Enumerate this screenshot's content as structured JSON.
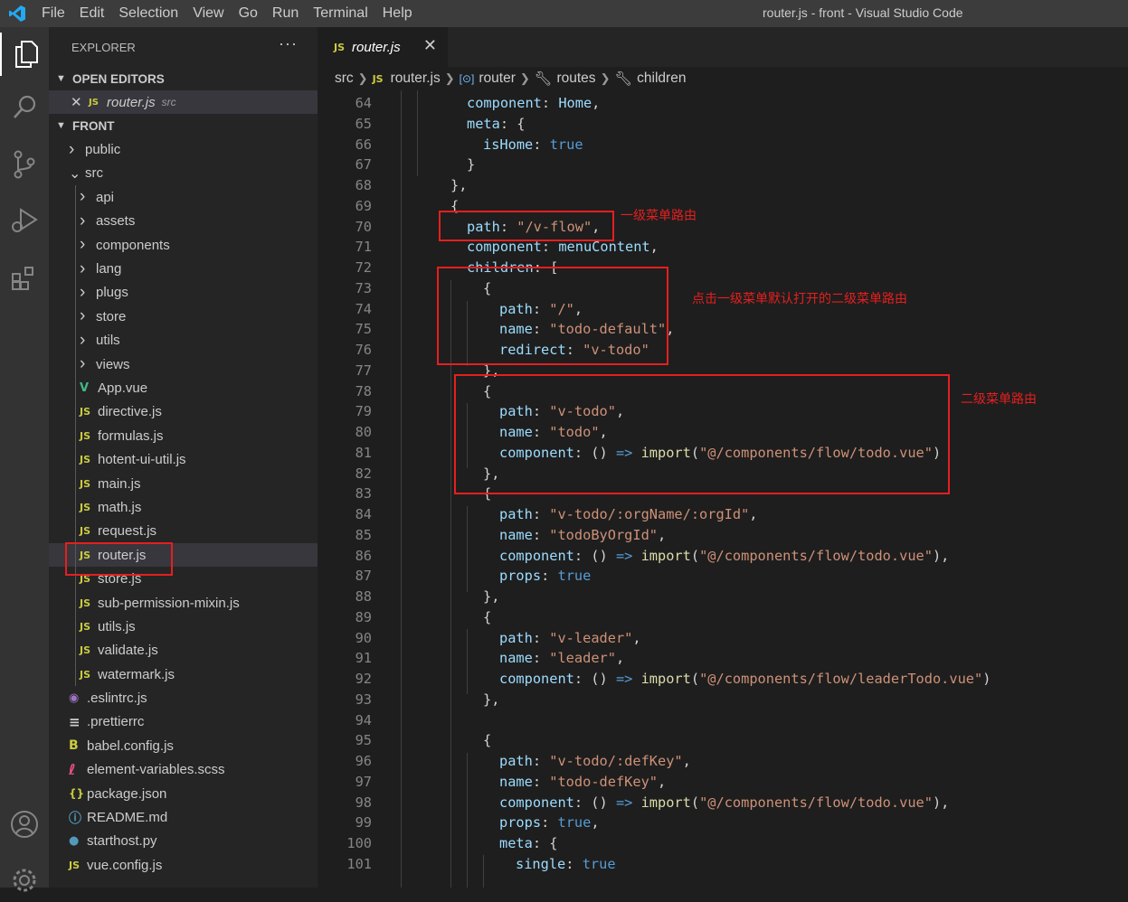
{
  "window": {
    "title": "router.js - front - Visual Studio Code"
  },
  "menu": [
    "File",
    "Edit",
    "Selection",
    "View",
    "Go",
    "Run",
    "Terminal",
    "Help"
  ],
  "activity_icons": [
    "files-icon",
    "search-icon",
    "source-control-icon",
    "run-debug-icon",
    "extensions-icon",
    "account-icon",
    "settings-gear-icon"
  ],
  "explorer": {
    "title": "EXPLORER",
    "more": "···",
    "open_editors_label": "OPEN EDITORS",
    "open_editor": {
      "name": "router.js",
      "dir": "src"
    },
    "project_label": "FRONT",
    "tree": [
      {
        "name": "public",
        "type": "folder",
        "level": 1
      },
      {
        "name": "src",
        "type": "folder-open",
        "level": 1
      },
      {
        "name": "api",
        "type": "folder",
        "level": 2
      },
      {
        "name": "assets",
        "type": "folder",
        "level": 2
      },
      {
        "name": "components",
        "type": "folder",
        "level": 2
      },
      {
        "name": "lang",
        "type": "folder",
        "level": 2
      },
      {
        "name": "plugs",
        "type": "folder",
        "level": 2
      },
      {
        "name": "store",
        "type": "folder",
        "level": 2
      },
      {
        "name": "utils",
        "type": "folder",
        "level": 2
      },
      {
        "name": "views",
        "type": "folder",
        "level": 2
      },
      {
        "name": "App.vue",
        "type": "vue",
        "level": 2
      },
      {
        "name": "directive.js",
        "type": "js",
        "level": 2
      },
      {
        "name": "formulas.js",
        "type": "js",
        "level": 2
      },
      {
        "name": "hotent-ui-util.js",
        "type": "js",
        "level": 2
      },
      {
        "name": "main.js",
        "type": "js",
        "level": 2
      },
      {
        "name": "math.js",
        "type": "js",
        "level": 2
      },
      {
        "name": "request.js",
        "type": "js",
        "level": 2
      },
      {
        "name": "router.js",
        "type": "js",
        "level": 2,
        "selected": true
      },
      {
        "name": "store.js",
        "type": "js",
        "level": 2
      },
      {
        "name": "sub-permission-mixin.js",
        "type": "js",
        "level": 2
      },
      {
        "name": "utils.js",
        "type": "js",
        "level": 2
      },
      {
        "name": "validate.js",
        "type": "js",
        "level": 2
      },
      {
        "name": "watermark.js",
        "type": "js",
        "level": 2
      },
      {
        "name": ".eslintrc.js",
        "type": "eslint",
        "level": 1
      },
      {
        "name": ".prettierrc",
        "type": "text",
        "level": 1
      },
      {
        "name": "babel.config.js",
        "type": "babel",
        "level": 1
      },
      {
        "name": "element-variables.scss",
        "type": "scss",
        "level": 1
      },
      {
        "name": "package.json",
        "type": "json",
        "level": 1
      },
      {
        "name": "README.md",
        "type": "info",
        "level": 1
      },
      {
        "name": "starthost.py",
        "type": "py",
        "level": 1
      },
      {
        "name": "vue.config.js",
        "type": "js",
        "level": 1
      }
    ]
  },
  "tab": {
    "name": "router.js",
    "badge": "JS",
    "close": "✕"
  },
  "breadcrumb": [
    "src",
    "router.js",
    "router",
    "routes",
    "children"
  ],
  "code_lines": [
    {
      "n": "64",
      "indent": 1,
      "t": [
        [
          "k",
          "component"
        ],
        [
          "p",
          ": "
        ],
        [
          "v",
          "Home"
        ],
        [
          "p",
          ","
        ]
      ]
    },
    {
      "n": "65",
      "indent": 1,
      "t": [
        [
          "k",
          "meta"
        ],
        [
          "p",
          ": {"
        ]
      ]
    },
    {
      "n": "66",
      "indent": 2,
      "t": [
        [
          "k",
          "isHome"
        ],
        [
          "p",
          ": "
        ],
        [
          "b",
          "true"
        ]
      ]
    },
    {
      "n": "67",
      "indent": 1,
      "t": [
        [
          "p",
          "}"
        ]
      ]
    },
    {
      "n": "68",
      "indent": 0,
      "t": [
        [
          "p",
          "},"
        ]
      ]
    },
    {
      "n": "69",
      "indent": 0,
      "t": [
        [
          "p",
          "{"
        ]
      ]
    },
    {
      "n": "70",
      "indent": 1,
      "t": [
        [
          "k",
          "path"
        ],
        [
          "p",
          ": "
        ],
        [
          "s",
          "\"/v-flow\""
        ],
        [
          "p",
          ","
        ]
      ]
    },
    {
      "n": "71",
      "indent": 1,
      "t": [
        [
          "k",
          "component"
        ],
        [
          "p",
          ": "
        ],
        [
          "v",
          "menuContent"
        ],
        [
          "p",
          ","
        ]
      ]
    },
    {
      "n": "72",
      "indent": 1,
      "t": [
        [
          "k",
          "children"
        ],
        [
          "p",
          ": ["
        ]
      ]
    },
    {
      "n": "73",
      "indent": 2,
      "t": [
        [
          "p",
          "{"
        ]
      ]
    },
    {
      "n": "74",
      "indent": 3,
      "t": [
        [
          "k",
          "path"
        ],
        [
          "p",
          ": "
        ],
        [
          "s",
          "\"/\""
        ],
        [
          "p",
          ","
        ]
      ]
    },
    {
      "n": "75",
      "indent": 3,
      "t": [
        [
          "k",
          "name"
        ],
        [
          "p",
          ": "
        ],
        [
          "s",
          "\"todo-default\""
        ],
        [
          "p",
          ","
        ]
      ]
    },
    {
      "n": "76",
      "indent": 3,
      "t": [
        [
          "k",
          "redirect"
        ],
        [
          "p",
          ": "
        ],
        [
          "s",
          "\"v-todo\""
        ]
      ]
    },
    {
      "n": "77",
      "indent": 2,
      "t": [
        [
          "p",
          "},"
        ]
      ]
    },
    {
      "n": "78",
      "indent": 2,
      "t": [
        [
          "p",
          "{"
        ]
      ]
    },
    {
      "n": "79",
      "indent": 3,
      "t": [
        [
          "k",
          "path"
        ],
        [
          "p",
          ": "
        ],
        [
          "s",
          "\"v-todo\""
        ],
        [
          "p",
          ","
        ]
      ]
    },
    {
      "n": "80",
      "indent": 3,
      "t": [
        [
          "k",
          "name"
        ],
        [
          "p",
          ": "
        ],
        [
          "s",
          "\"todo\""
        ],
        [
          "p",
          ","
        ]
      ]
    },
    {
      "n": "81",
      "indent": 3,
      "t": [
        [
          "k",
          "component"
        ],
        [
          "p",
          ": () "
        ],
        [
          "kw",
          "=>"
        ],
        [
          "p",
          " "
        ],
        [
          "f",
          "import"
        ],
        [
          "p",
          "("
        ],
        [
          "s",
          "\"@/components/flow/todo.vue\""
        ],
        [
          "p",
          ")"
        ]
      ]
    },
    {
      "n": "82",
      "indent": 2,
      "t": [
        [
          "p",
          "},"
        ]
      ]
    },
    {
      "n": "83",
      "indent": 2,
      "t": [
        [
          "p",
          "{"
        ]
      ]
    },
    {
      "n": "84",
      "indent": 3,
      "t": [
        [
          "k",
          "path"
        ],
        [
          "p",
          ": "
        ],
        [
          "s",
          "\"v-todo/:orgName/:orgId\""
        ],
        [
          "p",
          ","
        ]
      ]
    },
    {
      "n": "85",
      "indent": 3,
      "t": [
        [
          "k",
          "name"
        ],
        [
          "p",
          ": "
        ],
        [
          "s",
          "\"todoByOrgId\""
        ],
        [
          "p",
          ","
        ]
      ]
    },
    {
      "n": "86",
      "indent": 3,
      "t": [
        [
          "k",
          "component"
        ],
        [
          "p",
          ": () "
        ],
        [
          "kw",
          "=>"
        ],
        [
          "p",
          " "
        ],
        [
          "f",
          "import"
        ],
        [
          "p",
          "("
        ],
        [
          "s",
          "\"@/components/flow/todo.vue\""
        ],
        [
          "p",
          "),"
        ]
      ]
    },
    {
      "n": "87",
      "indent": 3,
      "t": [
        [
          "k",
          "props"
        ],
        [
          "p",
          ": "
        ],
        [
          "b",
          "true"
        ]
      ]
    },
    {
      "n": "88",
      "indent": 2,
      "t": [
        [
          "p",
          "},"
        ]
      ]
    },
    {
      "n": "89",
      "indent": 2,
      "t": [
        [
          "p",
          "{"
        ]
      ]
    },
    {
      "n": "90",
      "indent": 3,
      "t": [
        [
          "k",
          "path"
        ],
        [
          "p",
          ": "
        ],
        [
          "s",
          "\"v-leader\""
        ],
        [
          "p",
          ","
        ]
      ]
    },
    {
      "n": "91",
      "indent": 3,
      "t": [
        [
          "k",
          "name"
        ],
        [
          "p",
          ": "
        ],
        [
          "s",
          "\"leader\""
        ],
        [
          "p",
          ","
        ]
      ]
    },
    {
      "n": "92",
      "indent": 3,
      "t": [
        [
          "k",
          "component"
        ],
        [
          "p",
          ": () "
        ],
        [
          "kw",
          "=>"
        ],
        [
          "p",
          " "
        ],
        [
          "f",
          "import"
        ],
        [
          "p",
          "("
        ],
        [
          "s",
          "\"@/components/flow/leaderTodo.vue\""
        ],
        [
          "p",
          ")"
        ]
      ]
    },
    {
      "n": "93",
      "indent": 2,
      "t": [
        [
          "p",
          "},"
        ]
      ]
    },
    {
      "n": "94",
      "indent": 2,
      "t": []
    },
    {
      "n": "95",
      "indent": 2,
      "t": [
        [
          "p",
          "{"
        ]
      ]
    },
    {
      "n": "96",
      "indent": 3,
      "t": [
        [
          "k",
          "path"
        ],
        [
          "p",
          ": "
        ],
        [
          "s",
          "\"v-todo/:defKey\""
        ],
        [
          "p",
          ","
        ]
      ]
    },
    {
      "n": "97",
      "indent": 3,
      "t": [
        [
          "k",
          "name"
        ],
        [
          "p",
          ": "
        ],
        [
          "s",
          "\"todo-defKey\""
        ],
        [
          "p",
          ","
        ]
      ]
    },
    {
      "n": "98",
      "indent": 3,
      "t": [
        [
          "k",
          "component"
        ],
        [
          "p",
          ": () "
        ],
        [
          "kw",
          "=>"
        ],
        [
          "p",
          " "
        ],
        [
          "f",
          "import"
        ],
        [
          "p",
          "("
        ],
        [
          "s",
          "\"@/components/flow/todo.vue\""
        ],
        [
          "p",
          "),"
        ]
      ]
    },
    {
      "n": "99",
      "indent": 3,
      "t": [
        [
          "k",
          "props"
        ],
        [
          "p",
          ": "
        ],
        [
          "b",
          "true"
        ],
        [
          "p",
          ","
        ]
      ]
    },
    {
      "n": "100",
      "indent": 3,
      "t": [
        [
          "k",
          "meta"
        ],
        [
          "p",
          ": {"
        ]
      ]
    },
    {
      "n": "101",
      "indent": 4,
      "t": [
        [
          "k",
          "single"
        ],
        [
          "p",
          ": "
        ],
        [
          "b",
          "true"
        ]
      ]
    }
  ],
  "annotations": {
    "first_level": "一级菜单路由",
    "default_open": "点击一级菜单默认打开的二级菜单路由",
    "second_level": "二级菜单路由"
  }
}
